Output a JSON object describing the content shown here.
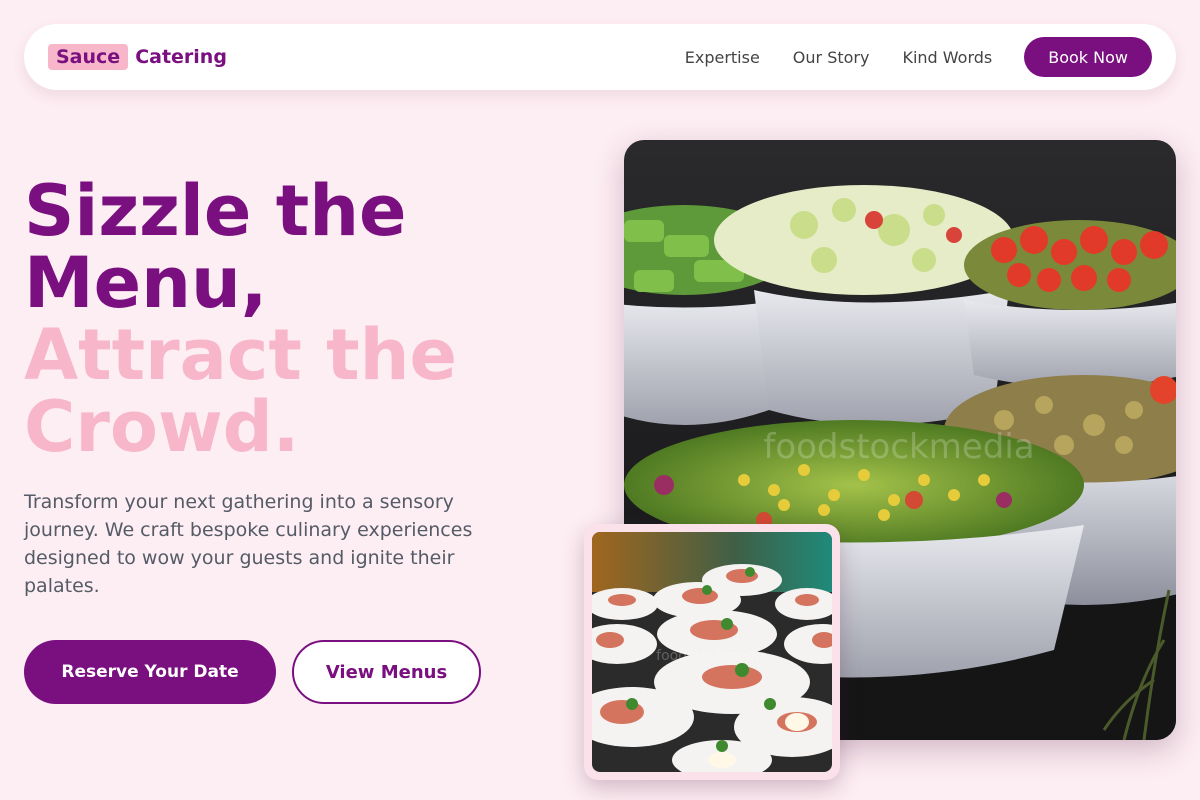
{
  "brand": {
    "mark": "Sauce",
    "name": "Catering"
  },
  "nav": {
    "links": [
      "Expertise",
      "Our Story",
      "Kind Words"
    ],
    "cta": "Book Now"
  },
  "hero": {
    "title_line1": "Sizzle the Menu,",
    "title_line2": "Attract the Crowd.",
    "description": "Transform your next gathering into a sensory journey. We craft bespoke culinary experiences designed to wow your guests and ignite their palates.",
    "primary_button": "Reserve Your Date",
    "secondary_button": "View Menus"
  },
  "images": {
    "main_watermark": "foodstockmedia",
    "thumb_watermark": "foodstockmedia"
  },
  "colors": {
    "background": "#fdeef3",
    "brand_purple": "#7a0f80",
    "brand_pink": "#f7b6c9",
    "body_text": "#555b66"
  }
}
